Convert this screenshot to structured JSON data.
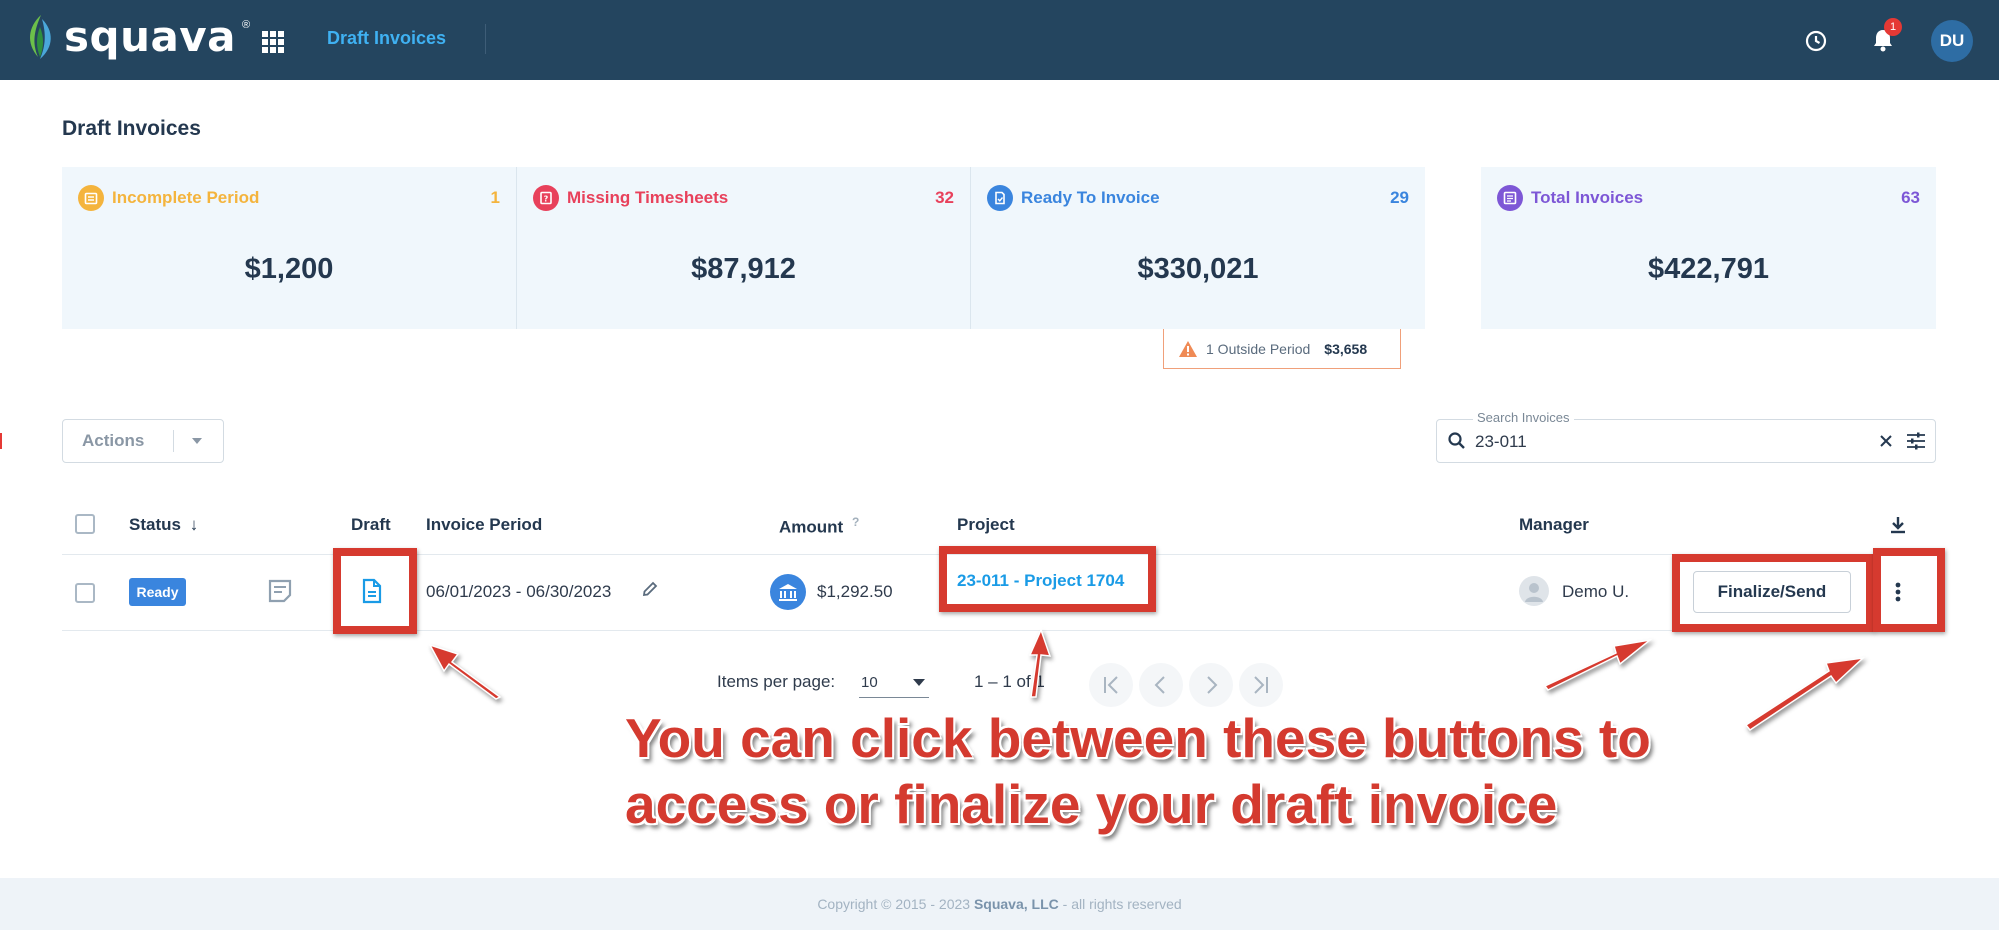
{
  "brand": {
    "name": "squava",
    "reg": "®"
  },
  "nav": {
    "title": "Draft Invoices",
    "user_initials": "DU",
    "notification_count": "1"
  },
  "page": {
    "title": "Draft Invoices"
  },
  "cards": [
    {
      "label": "Incomplete Period",
      "count": "1",
      "amount": "$1,200",
      "color": "#f4b43d"
    },
    {
      "label": "Missing Timesheets",
      "count": "32",
      "amount": "$87,912",
      "color": "#e8415b"
    },
    {
      "label": "Ready To Invoice",
      "count": "29",
      "amount": "$330,021",
      "color": "#3a85de"
    },
    {
      "label": "Total Invoices",
      "count": "63",
      "amount": "$422,791",
      "color": "#7d57d6"
    }
  ],
  "outside_period": {
    "label": "1 Outside Period",
    "amount": "$3,658"
  },
  "toolbar": {
    "actions_label": "Actions",
    "search_label": "Search Invoices",
    "search_value": "23-011"
  },
  "table": {
    "headers": {
      "status": "Status",
      "draft": "Draft",
      "period": "Invoice Period",
      "amount": "Amount",
      "amount_hint": "?",
      "project": "Project",
      "manager": "Manager"
    },
    "rows": [
      {
        "status": "Ready",
        "period": "06/01/2023 - 06/30/2023",
        "amount": "$1,292.50",
        "project": "23-011 - Project 1704",
        "manager": "Demo U.",
        "action": "Finalize/Send"
      }
    ]
  },
  "pagination": {
    "items_label": "Items per page:",
    "per_page": "10",
    "range": "1 – 1 of 1"
  },
  "annotation": {
    "line1": "You can click between these buttons to",
    "line2": "access or finalize your draft invoice"
  },
  "footer": {
    "prefix": "Copyright © 2015 - 2023 ",
    "company": "Squava, LLC",
    "suffix": " - all rights reserved"
  },
  "colors": {
    "topbar": "#24455f",
    "accent": "#1a9be6",
    "annotation_red": "#d63a2f"
  }
}
